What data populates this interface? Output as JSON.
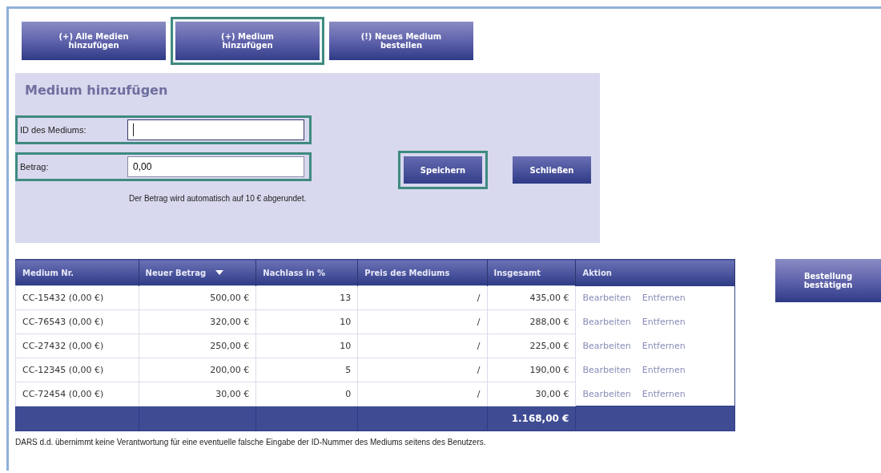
{
  "tabs": [
    {
      "label": "(+) Alle Medien hinzufügen",
      "selected": false
    },
    {
      "label": "(+) Medium hinzufügen",
      "selected": true
    },
    {
      "label": "(!) Neues Medium bestellen",
      "selected": false
    }
  ],
  "form": {
    "title": "Medium hinzufügen",
    "fields": [
      {
        "label": "ID des Mediums:",
        "focused": true,
        "highlighted": true
      },
      {
        "label": "Betrag:",
        "value": "0,00",
        "focused": false,
        "highlighted": true
      }
    ],
    "hint": "Der Betrag wird automatisch auf 10 € abgerundet.",
    "buttons": [
      {
        "label": "Speichern",
        "highlighted": true
      },
      {
        "label": "Schließen",
        "highlighted": false
      }
    ]
  },
  "table": {
    "columns": [
      {
        "label": "Medium Nr.",
        "sorted": false
      },
      {
        "label": "Neuer Betrag",
        "sorted": true
      },
      {
        "label": "Nachlass in %",
        "sorted": false
      },
      {
        "label": "Preis des Mediums",
        "sorted": false
      },
      {
        "label": "Insgesamt",
        "sorted": false
      },
      {
        "label": "Aktion",
        "sorted": false
      }
    ],
    "rows": [
      {
        "cells": [
          "CC-15432 (0,00 €)",
          "500,00 €",
          "13",
          "/",
          "435,00 €"
        ],
        "actions": [
          "Bearbeiten",
          "Entfernen"
        ]
      },
      {
        "cells": [
          "CC-76543 (0,00 €)",
          "320,00 €",
          "10",
          "/",
          "288,00 €"
        ],
        "actions": [
          "Bearbeiten",
          "Entfernen"
        ]
      },
      {
        "cells": [
          "CC-27432 (0,00 €)",
          "250,00 €",
          "10",
          "/",
          "225,00 €"
        ],
        "actions": [
          "Bearbeiten",
          "Entfernen"
        ]
      },
      {
        "cells": [
          "CC-12345 (0,00 €)",
          "200,00 €",
          "5",
          "/",
          "190,00 €"
        ],
        "actions": [
          "Bearbeiten",
          "Entfernen"
        ]
      },
      {
        "cells": [
          "CC-72454 (0,00 €)",
          "30,00 €",
          "0",
          "/",
          "30,00 €"
        ],
        "actions": [
          "Bearbeiten",
          "Entfernen"
        ]
      }
    ],
    "footer": {
      "total": "1.168,00 €"
    }
  },
  "confirm_button": {
    "label": "Bestellung bestätigen"
  },
  "disclaimer": "DARS d.d. übernimmt keine Verantwortung für eine eventuelle falsche Eingabe der ID-Nummer des Mediums seitens des Benutzers."
}
